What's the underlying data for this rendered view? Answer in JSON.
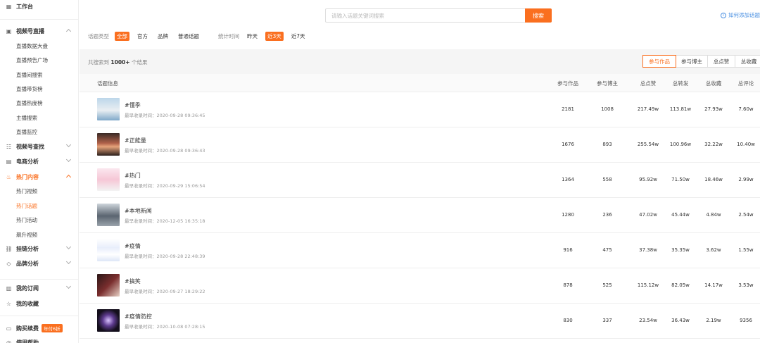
{
  "sidebar": {
    "items": [
      {
        "icon": "grid-icon",
        "label": "工作台",
        "type": "top"
      },
      {
        "icon": "live-icon",
        "label": "视频号直播",
        "type": "top",
        "chevron": "up"
      },
      {
        "label": "直播数据大盘",
        "type": "sub"
      },
      {
        "label": "直播预告广场",
        "type": "sub"
      },
      {
        "label": "直播间搜索",
        "type": "sub"
      },
      {
        "label": "直播带货榜",
        "type": "sub"
      },
      {
        "label": "直播热度榜",
        "type": "sub"
      },
      {
        "label": "主播搜索",
        "type": "sub"
      },
      {
        "label": "直播监控",
        "type": "sub"
      },
      {
        "icon": "list-search-icon",
        "label": "视频号查找",
        "type": "top",
        "chevron": "down"
      },
      {
        "icon": "shop-icon",
        "label": "电商分析",
        "type": "top",
        "chevron": "down"
      },
      {
        "icon": "flame-icon",
        "label": "热门内容",
        "type": "top",
        "chevron": "up",
        "open": true
      },
      {
        "label": "热门视频",
        "type": "sub"
      },
      {
        "label": "热门话题",
        "type": "sub",
        "active": true
      },
      {
        "label": "热门活动",
        "type": "sub"
      },
      {
        "label": "飙升视频",
        "type": "sub"
      },
      {
        "icon": "link-icon",
        "label": "挂链分析",
        "type": "top",
        "chevron": "down"
      },
      {
        "icon": "tag-icon",
        "label": "品牌分析",
        "type": "top",
        "chevron": "down"
      },
      {
        "icon": "subscription-icon",
        "label": "我的订阅",
        "type": "top",
        "chevron": "down"
      },
      {
        "icon": "star-icon",
        "label": "我的收藏",
        "type": "top"
      },
      {
        "icon": "cart-icon",
        "label": "购买续费",
        "type": "top",
        "badge": "年付6折"
      },
      {
        "icon": "help-icon",
        "label": "使用帮助",
        "type": "top"
      }
    ]
  },
  "search": {
    "placeholder": "请输入话题关键词搜索",
    "button": "搜索"
  },
  "help_link": "如何添加话题",
  "filters": {
    "type_label": "话题类型",
    "type_options": [
      "全部",
      "官方",
      "品牌",
      "普通话题"
    ],
    "type_selected": 0,
    "time_label": "统计时间",
    "time_options": [
      "昨天",
      "近3天",
      "近7天"
    ],
    "time_selected": 1
  },
  "summary": {
    "prefix": "共搜索到",
    "count": "1000+",
    "suffix": "个结果"
  },
  "sort_tabs": [
    "参与作品",
    "参与博主",
    "总点赞",
    "总收藏"
  ],
  "sort_selected": 0,
  "table": {
    "headers": [
      "话题信息",
      "参与作品",
      "参与博主",
      "总点赞",
      "总转发",
      "总收藏",
      "总评论"
    ],
    "time_prefix": "最早收录时间：",
    "rows": [
      {
        "name": "#懂季",
        "time": "2020-09-28 09:36:45",
        "works": "2181",
        "bloggers": "1008",
        "likes": "217.49w",
        "shares": "113.81w",
        "favs": "27.93w",
        "comments": "7.60w"
      },
      {
        "name": "#正能量",
        "time": "2020-09-28 09:36:43",
        "works": "1676",
        "bloggers": "893",
        "likes": "255.54w",
        "shares": "100.96w",
        "favs": "32.22w",
        "comments": "10.40w"
      },
      {
        "name": "#热门",
        "time": "2020-09-29 15:06:54",
        "works": "1364",
        "bloggers": "558",
        "likes": "95.92w",
        "shares": "71.50w",
        "favs": "18.46w",
        "comments": "2.99w"
      },
      {
        "name": "#本地新闻",
        "time": "2020-12-05 16:35:18",
        "works": "1280",
        "bloggers": "236",
        "likes": "47.02w",
        "shares": "45.44w",
        "favs": "4.84w",
        "comments": "2.54w"
      },
      {
        "name": "#疫情",
        "time": "2020-09-28 22:48:39",
        "works": "916",
        "bloggers": "475",
        "likes": "37.38w",
        "shares": "35.35w",
        "favs": "3.62w",
        "comments": "1.55w"
      },
      {
        "name": "#搞笑",
        "time": "2020-09-27 18:29:22",
        "works": "878",
        "bloggers": "525",
        "likes": "115.12w",
        "shares": "82.05w",
        "favs": "14.17w",
        "comments": "3.53w"
      },
      {
        "name": "#疫情防控",
        "time": "2020-10-08 07:28:15",
        "works": "830",
        "bloggers": "337",
        "likes": "23.54w",
        "shares": "36.43w",
        "favs": "2.19w",
        "comments": "9356"
      }
    ]
  },
  "colors": {
    "accent": "#fa6f1f",
    "link": "#4a90e2"
  }
}
